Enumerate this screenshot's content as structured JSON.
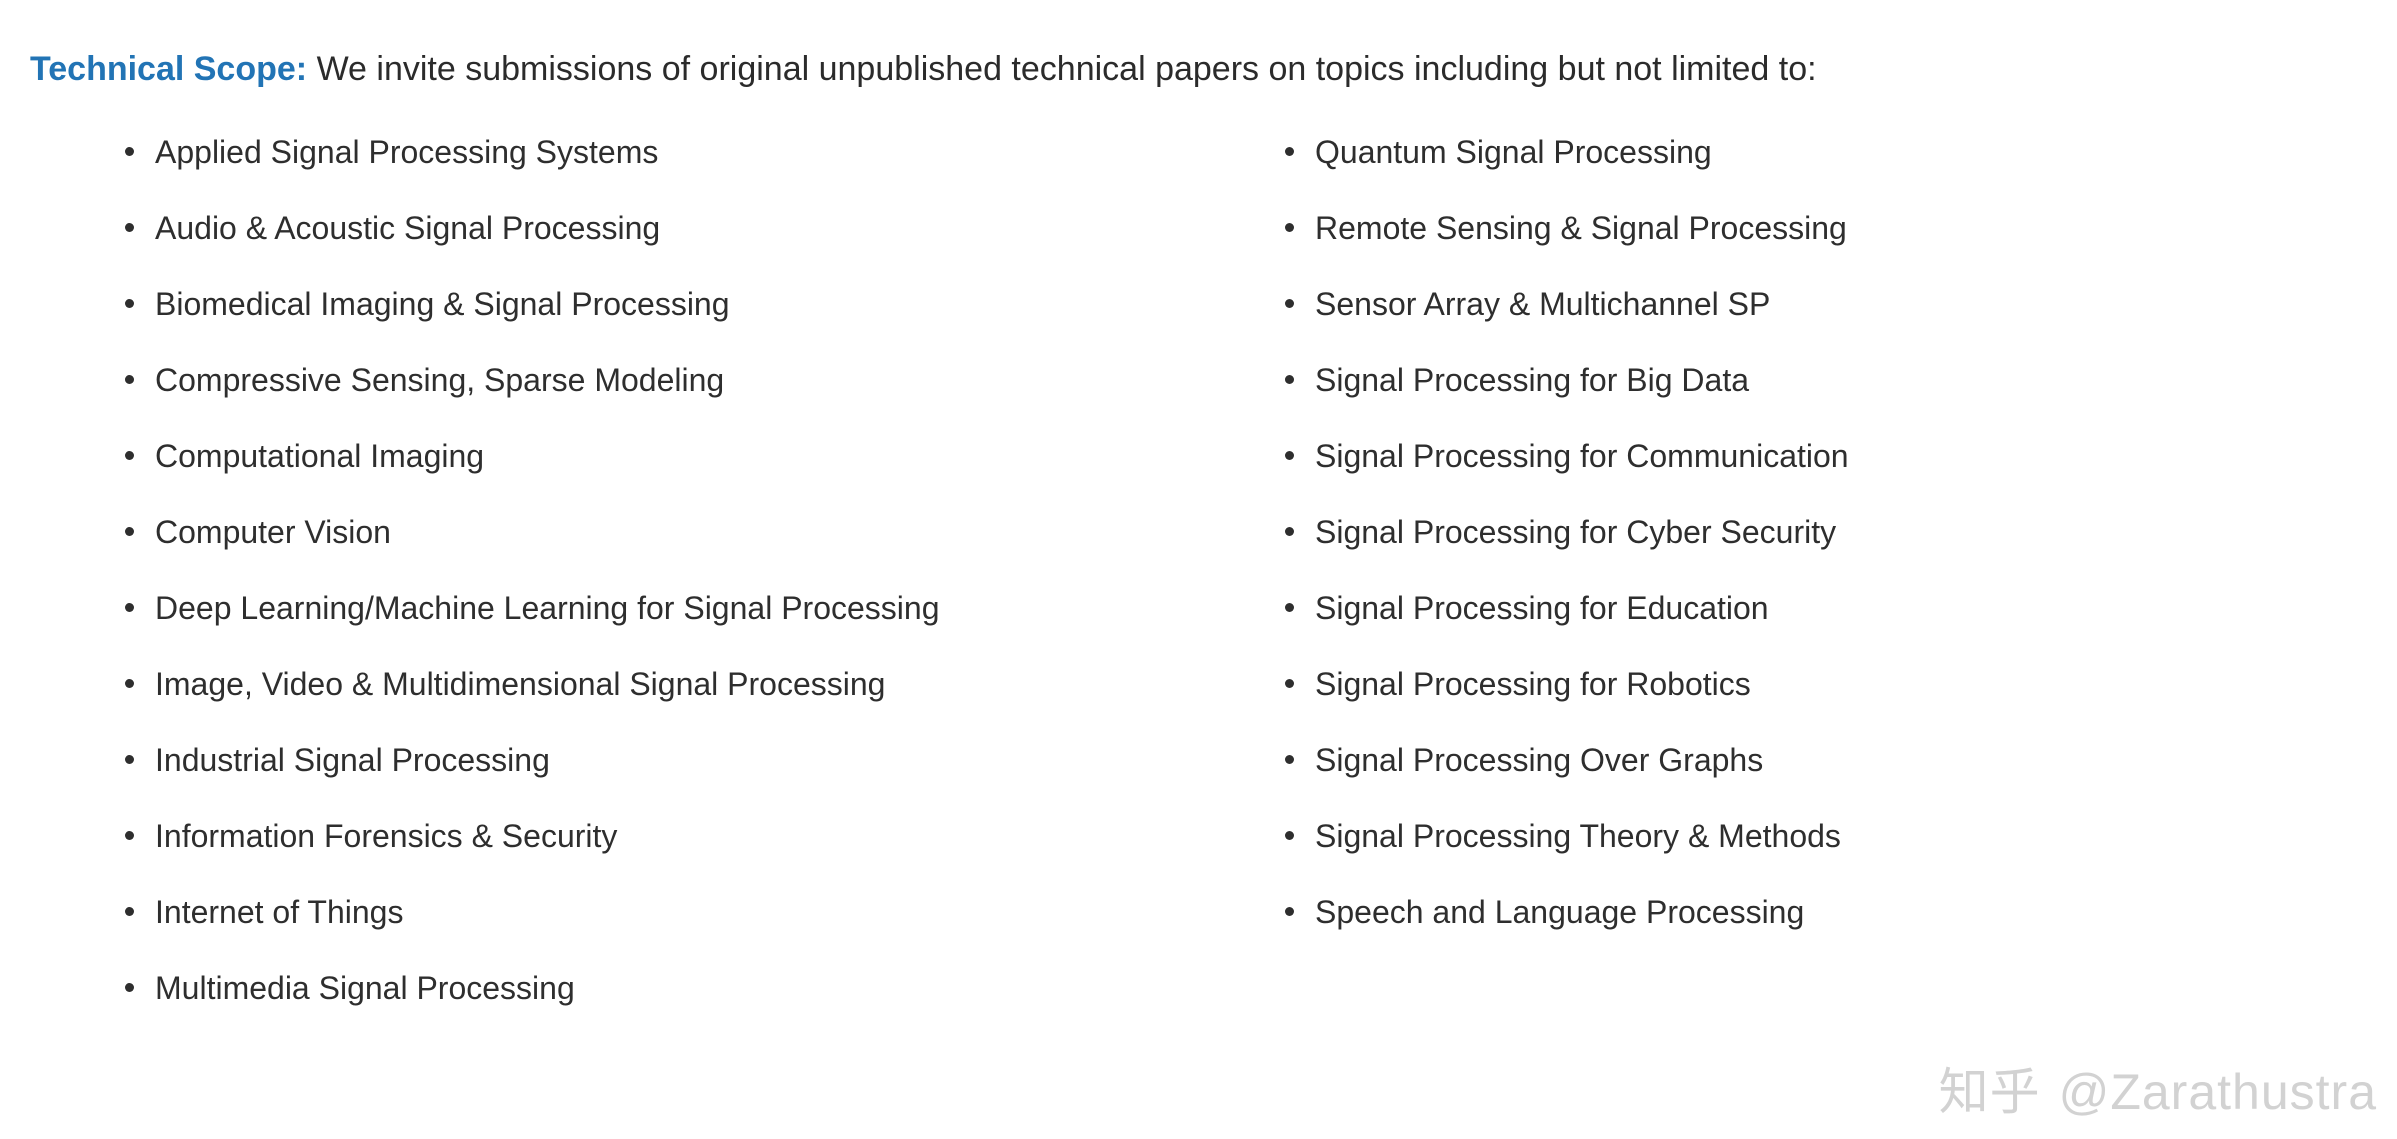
{
  "header": {
    "label": "Technical Scope:",
    "body": " We invite submissions of original unpublished technical papers on topics including but not limited to:",
    "label_color": "#2274b5",
    "body_color": "#2b2b2b"
  },
  "topics": {
    "left_column": [
      {
        "label": "Applied Signal Processing Systems",
        "wraps": false
      },
      {
        "label": "Audio & Acoustic Signal Processing",
        "wraps": false
      },
      {
        "label": "Biomedical Imaging & Signal Processing",
        "wraps": false
      },
      {
        "label": "Compressive Sensing, Sparse Modeling",
        "wraps": false
      },
      {
        "label": "Computational Imaging",
        "wraps": false
      },
      {
        "label": "Computer Vision",
        "wraps": false
      },
      {
        "label": "Deep Learning/Machine Learning for Signal Processing",
        "wraps": true
      },
      {
        "label": "Image, Video & Multidimensional Signal Processing",
        "wraps": false
      },
      {
        "label": "Industrial Signal Processing",
        "wraps": false
      },
      {
        "label": "Information Forensics & Security",
        "wraps": false
      },
      {
        "label": "Internet of Things",
        "wraps": false
      },
      {
        "label": "Multimedia Signal Processing",
        "wraps": false
      }
    ],
    "right_column": [
      {
        "label": "Quantum Signal Processing",
        "wraps": false
      },
      {
        "label": "Remote Sensing & Signal Processing",
        "wraps": false
      },
      {
        "label": "Sensor Array & Multichannel SP",
        "wraps": false
      },
      {
        "label": "Signal Processing for Big Data",
        "wraps": false
      },
      {
        "label": "Signal Processing for Communication",
        "wraps": false
      },
      {
        "label": "Signal Processing for Cyber Security",
        "wraps": false
      },
      {
        "label": "Signal Processing for Education",
        "wraps": false
      },
      {
        "label": "Signal Processing for Robotics",
        "wraps": false
      },
      {
        "label": "Signal Processing Over Graphs",
        "wraps": false
      },
      {
        "label": "Signal Processing Theory & Methods",
        "wraps": false
      },
      {
        "label": "Speech and Language Processing",
        "wraps": false
      }
    ]
  },
  "watermark": {
    "logo": "知乎",
    "handle": "@Zarathustra",
    "color": "#d2d2d2"
  }
}
